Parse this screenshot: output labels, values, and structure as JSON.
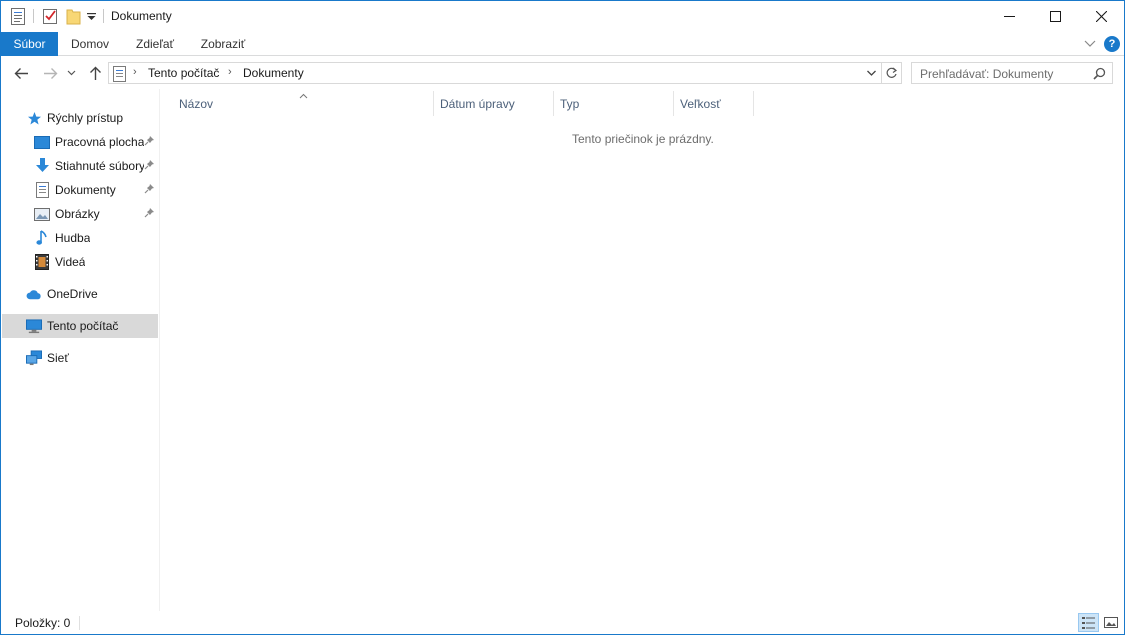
{
  "window": {
    "title": "Dokumenty"
  },
  "ribbon": {
    "tabs": [
      {
        "label": "Súbor"
      },
      {
        "label": "Domov"
      },
      {
        "label": "Zdieľať"
      },
      {
        "label": "Zobraziť"
      }
    ],
    "help": "?"
  },
  "address": {
    "crumbs": [
      "Tento počítač",
      "Dokumenty"
    ],
    "separator": "›"
  },
  "search": {
    "placeholder": "Prehľadávať: Dokumenty"
  },
  "navpane": {
    "quick_access": "Rýchly prístup",
    "pinned": [
      {
        "label": "Pracovná plocha",
        "icon": "desktop-icon"
      },
      {
        "label": "Stiahnuté súbory",
        "icon": "download-icon"
      },
      {
        "label": "Dokumenty",
        "icon": "documents-icon"
      },
      {
        "label": "Obrázky",
        "icon": "pictures-icon"
      }
    ],
    "unpinned": [
      {
        "label": "Hudba",
        "icon": "music-icon"
      },
      {
        "label": "Videá",
        "icon": "videos-icon"
      }
    ],
    "onedrive": "OneDrive",
    "this_pc": "Tento počítač",
    "network": "Sieť"
  },
  "content": {
    "columns": [
      "Názov",
      "Dátum úpravy",
      "Typ",
      "Veľkosť"
    ],
    "empty_message": "Tento priečinok je prázdny."
  },
  "status": {
    "items_text": "Položky: 0"
  },
  "colors": {
    "accent": "#1979ca",
    "selected_bg": "#d9d9d9",
    "column_header": "#4c607a"
  }
}
